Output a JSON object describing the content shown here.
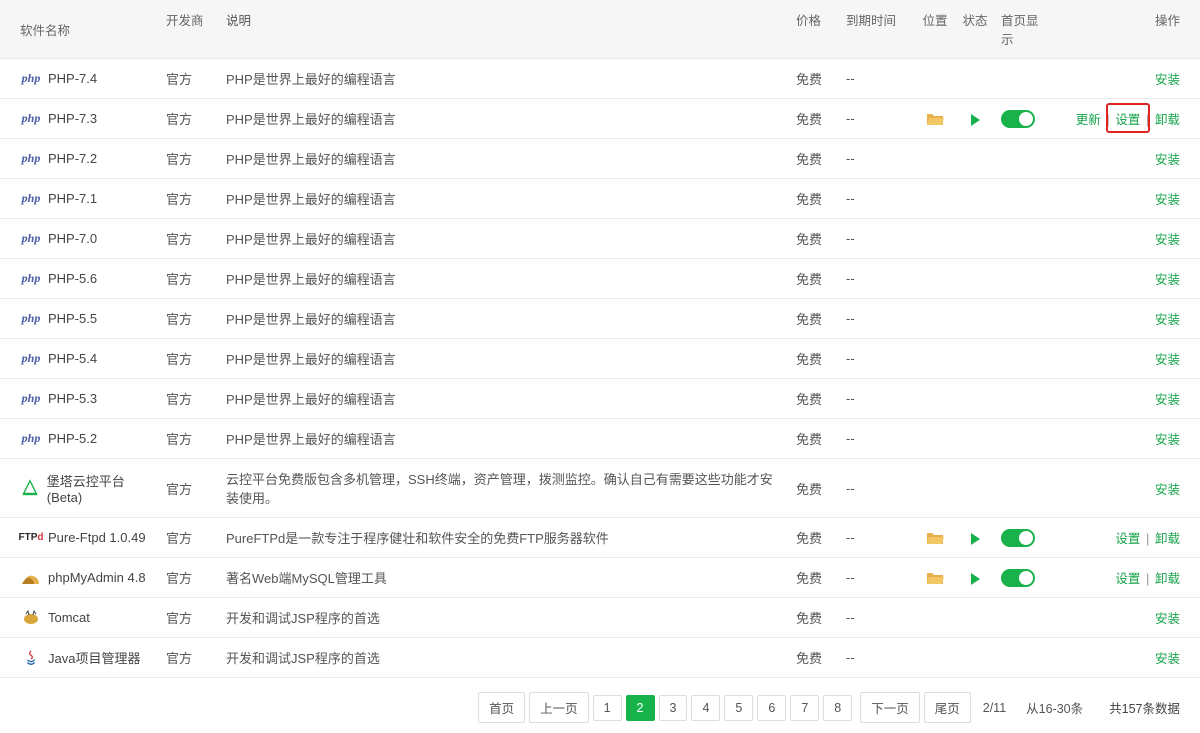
{
  "columns": {
    "name": "软件名称",
    "dev": "开发商",
    "desc": "说明",
    "price": "价格",
    "expire": "到期时间",
    "loc": "位置",
    "state": "状态",
    "home": "首页显示",
    "action": "操作"
  },
  "labels": {
    "install": "安装",
    "update": "更新",
    "settings": "设置",
    "uninstall": "卸载"
  },
  "rows": [
    {
      "icon": "php",
      "name": "PHP-7.4",
      "dev": "官方",
      "desc": "PHP是世界上最好的编程语言",
      "price": "免费",
      "expire": "--",
      "installed": false,
      "folder": false,
      "run": false,
      "toggle": false
    },
    {
      "icon": "php",
      "name": "PHP-7.3",
      "dev": "官方",
      "desc": "PHP是世界上最好的编程语言",
      "price": "免费",
      "expire": "--",
      "installed": true,
      "folder": true,
      "run": true,
      "toggle": true,
      "showUpdate": true,
      "highlight": true
    },
    {
      "icon": "php",
      "name": "PHP-7.2",
      "dev": "官方",
      "desc": "PHP是世界上最好的编程语言",
      "price": "免费",
      "expire": "--",
      "installed": false
    },
    {
      "icon": "php",
      "name": "PHP-7.1",
      "dev": "官方",
      "desc": "PHP是世界上最好的编程语言",
      "price": "免费",
      "expire": "--",
      "installed": false
    },
    {
      "icon": "php",
      "name": "PHP-7.0",
      "dev": "官方",
      "desc": "PHP是世界上最好的编程语言",
      "price": "免费",
      "expire": "--",
      "installed": false
    },
    {
      "icon": "php",
      "name": "PHP-5.6",
      "dev": "官方",
      "desc": "PHP是世界上最好的编程语言",
      "price": "免费",
      "expire": "--",
      "installed": false
    },
    {
      "icon": "php",
      "name": "PHP-5.5",
      "dev": "官方",
      "desc": "PHP是世界上最好的编程语言",
      "price": "免费",
      "expire": "--",
      "installed": false
    },
    {
      "icon": "php",
      "name": "PHP-5.4",
      "dev": "官方",
      "desc": "PHP是世界上最好的编程语言",
      "price": "免费",
      "expire": "--",
      "installed": false
    },
    {
      "icon": "php",
      "name": "PHP-5.3",
      "dev": "官方",
      "desc": "PHP是世界上最好的编程语言",
      "price": "免费",
      "expire": "--",
      "installed": false
    },
    {
      "icon": "php",
      "name": "PHP-5.2",
      "dev": "官方",
      "desc": "PHP是世界上最好的编程语言",
      "price": "免费",
      "expire": "--",
      "installed": false
    },
    {
      "icon": "bt",
      "name": "堡塔云控平台(Beta)",
      "dev": "官方",
      "desc": "云控平台免费版包含多机管理，SSH终端，资产管理，拨测监控。确认自己有需要这些功能才安装使用。",
      "price": "免费",
      "expire": "--",
      "installed": false
    },
    {
      "icon": "ftp",
      "name": "Pure-Ftpd 1.0.49",
      "dev": "官方",
      "desc": "PureFTPd是一款专注于程序健壮和软件安全的免费FTP服务器软件",
      "price": "免费",
      "expire": "--",
      "installed": true,
      "folder": true,
      "run": true,
      "toggle": true
    },
    {
      "icon": "pma",
      "name": "phpMyAdmin 4.8",
      "dev": "官方",
      "desc": "著名Web端MySQL管理工具",
      "price": "免费",
      "expire": "--",
      "installed": true,
      "folder": true,
      "run": true,
      "toggle": true
    },
    {
      "icon": "tomcat",
      "name": "Tomcat",
      "dev": "官方",
      "desc": "开发和调试JSP程序的首选",
      "price": "免费",
      "expire": "--",
      "installed": false
    },
    {
      "icon": "java",
      "name": "Java项目管理器",
      "dev": "官方",
      "desc": "开发和调试JSP程序的首选",
      "price": "免费",
      "expire": "--",
      "installed": false
    }
  ],
  "pagination": {
    "first": "首页",
    "prev": "上一页",
    "pages": [
      "1",
      "2",
      "3",
      "4",
      "5",
      "6",
      "7",
      "8"
    ],
    "current": "2",
    "next": "下一页",
    "last": "尾页",
    "range": "2/11",
    "slice": "从16-30条",
    "total": "共157条数据"
  }
}
